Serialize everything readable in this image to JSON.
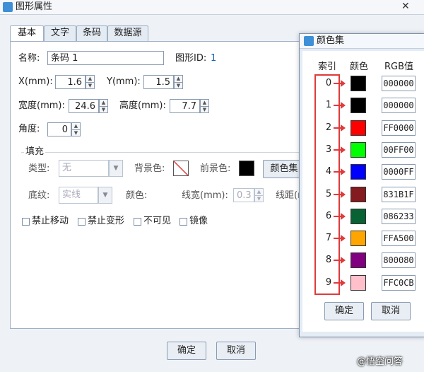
{
  "window": {
    "title": "图形属性",
    "close": "✕"
  },
  "tabs": [
    "基本",
    "文字",
    "条码",
    "数据源"
  ],
  "basic": {
    "name_label": "名称:",
    "name_value": "条码 1",
    "id_label": "图形ID:",
    "id_value": "1",
    "x_label": "X(mm):",
    "x_value": "1.6",
    "y_label": "Y(mm):",
    "y_value": "1.5",
    "width_label": "宽度(mm):",
    "width_value": "24.6",
    "height_label": "高度(mm):",
    "height_value": "7.7",
    "angle_label": "角度:",
    "angle_value": "0"
  },
  "fill": {
    "group_label": "填充",
    "type_label": "类型:",
    "type_value": "无",
    "bg_label": "背景色:",
    "fg_label": "前景色:",
    "colorset_button": "颜色集",
    "pattern_label": "底纹:",
    "pattern_value": "实线",
    "color_label": "颜色:",
    "linewidth_label": "线宽(mm):",
    "linewidth_value": "0.3",
    "linegap_label": "线距(m"
  },
  "checkboxes": [
    "禁止移动",
    "禁止变形",
    "不可见",
    "镜像"
  ],
  "footer": {
    "ok": "确定",
    "cancel": "取消"
  },
  "color_dialog": {
    "title": "颜色集",
    "headers": {
      "index": "索引",
      "color": "颜色",
      "rgb": "RGB值"
    },
    "rows": [
      {
        "index": "0",
        "color": "#000000",
        "rgb": "000000"
      },
      {
        "index": "1",
        "color": "#000000",
        "rgb": "000000"
      },
      {
        "index": "2",
        "color": "#FF0000",
        "rgb": "FF0000"
      },
      {
        "index": "3",
        "color": "#00FF00",
        "rgb": "00FF00"
      },
      {
        "index": "4",
        "color": "#0000FF",
        "rgb": "0000FF"
      },
      {
        "index": "5",
        "color": "#831B1F",
        "rgb": "831B1F"
      },
      {
        "index": "6",
        "color": "#086233",
        "rgb": "086233"
      },
      {
        "index": "7",
        "color": "#FFA500",
        "rgb": "FFA500"
      },
      {
        "index": "8",
        "color": "#800080",
        "rgb": "800080"
      },
      {
        "index": "9",
        "color": "#FFC0CB",
        "rgb": "FFC0CB"
      }
    ],
    "ok": "确定",
    "cancel": "取消"
  },
  "watermark": "@悟空问答",
  "accent_color": "#E03A3A"
}
